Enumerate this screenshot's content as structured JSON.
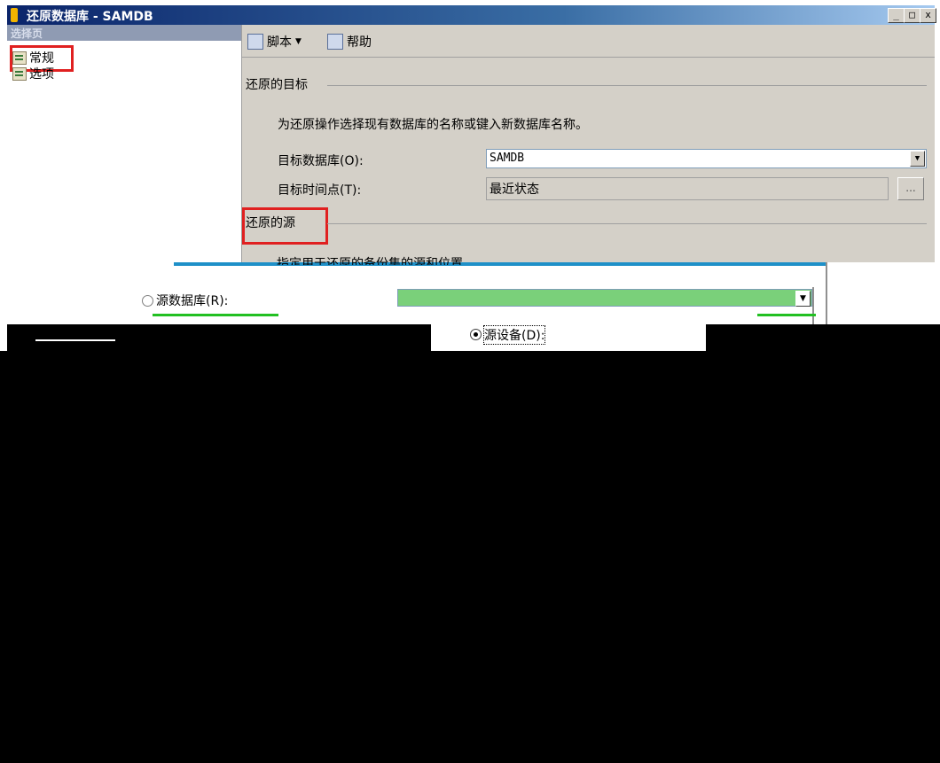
{
  "window": {
    "title": "还原数据库 - SAMDB",
    "minimize": "_",
    "maximize": "□",
    "close": "x"
  },
  "sidebar": {
    "header": "选择页",
    "items": [
      {
        "label": "常规"
      },
      {
        "label": "选项"
      }
    ]
  },
  "toolbar": {
    "script_label": "脚本",
    "help_label": "帮助"
  },
  "destination": {
    "section_title": "还原的目标",
    "description": "为还原操作选择现有数据库的名称或键入新数据库名称。",
    "target_db_label": "目标数据库(O):",
    "target_db_value": "SAMDB",
    "target_time_label": "目标时间点(T):",
    "target_time_value": "最近状态",
    "browse_label": "..."
  },
  "source": {
    "section_title": "还原的源",
    "description": "指定用于还原的备份集的源和位置",
    "source_db_label": "源数据库(R):",
    "source_device_label": "源设备(D):"
  },
  "colors": {
    "highlight": "#e02020",
    "green_highlight": "#22c022",
    "source_db_fill": "#7ad07a"
  }
}
